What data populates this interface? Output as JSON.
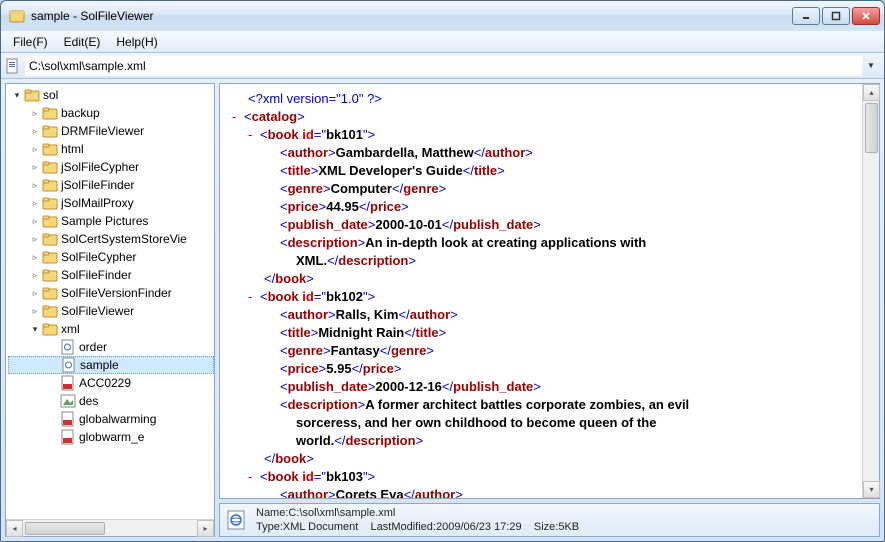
{
  "window": {
    "title": "sample - SolFileViewer"
  },
  "menubar": {
    "file": "File(F)",
    "edit": "Edit(E)",
    "help": "Help(H)"
  },
  "address": {
    "path": "C:\\sol\\xml\\sample.xml"
  },
  "tree": {
    "root": "sol",
    "items": [
      "backup",
      "DRMFileViewer",
      "html",
      "jSolFileCypher",
      "jSolFileFinder",
      "jSolMailProxy",
      "Sample Pictures",
      "SolCertSystemStoreVie",
      "SolFileCypher",
      "SolFileFinder",
      "SolFileVersionFinder",
      "SolFileViewer"
    ],
    "xml_folder": "xml",
    "xml_children": {
      "order": "order",
      "sample": "sample",
      "acc": "ACC0229",
      "des": "des",
      "gw": "globalwarming",
      "gwe": "globwarm_e"
    }
  },
  "xml": {
    "decl": "<?xml version=\"1.0\" ?>",
    "catalog_open": "catalog",
    "book": "book",
    "id_attr": "id",
    "author": "author",
    "title": "title",
    "genre": "genre",
    "price": "price",
    "publish_date": "publish_date",
    "description": "description",
    "b1": {
      "id": "bk101",
      "author": "Gambardella, Matthew",
      "title": "XML Developer's Guide",
      "genre": "Computer",
      "price": "44.95",
      "date": "2000-10-01",
      "desc1": "An in-depth look at creating applications with",
      "desc2": "XML."
    },
    "b2": {
      "id": "bk102",
      "author": "Ralls, Kim",
      "title": "Midnight Rain",
      "genre": "Fantasy",
      "price": "5.95",
      "date": "2000-12-16",
      "desc1": "A former architect battles corporate zombies, an evil",
      "desc2": "sorceress, and her own childhood to become queen of the",
      "desc3": "world."
    },
    "b3": {
      "id": "bk103",
      "author_partial": "Corets  Eva"
    }
  },
  "status": {
    "line1_label": "Name:",
    "line1_value": "C:\\sol\\xml\\sample.xml",
    "line2_type_label": "Type:",
    "line2_type_value": "XML Document",
    "line2_lm_label": "LastModified:",
    "line2_lm_value": "2009/06/23 17:29",
    "line2_size_label": "Size:",
    "line2_size_value": "5KB"
  }
}
